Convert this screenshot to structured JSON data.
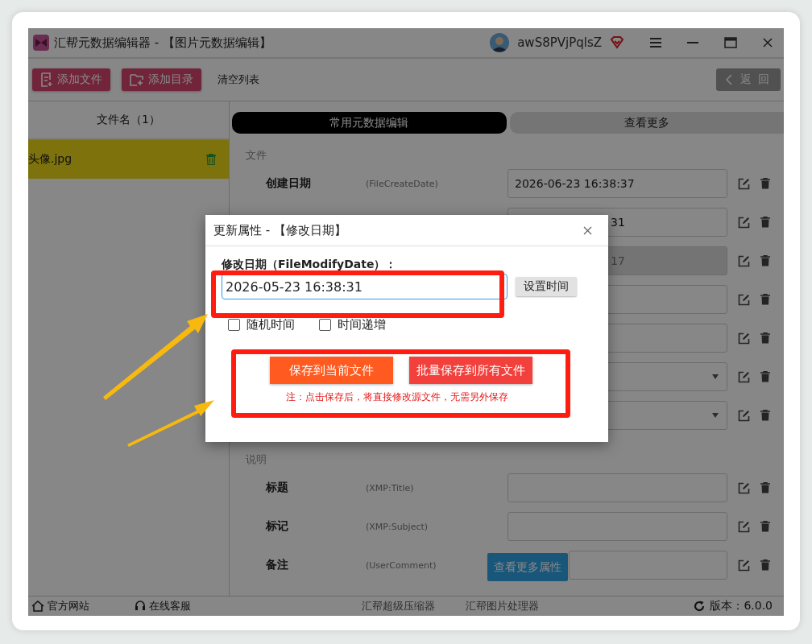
{
  "window": {
    "title": "汇帮元数据编辑器 - 【图片元数据编辑】",
    "user": "awS8PVjPqlsZ"
  },
  "toolbar": {
    "buttons": [
      {
        "label": "添加文件",
        "kind": "file"
      },
      {
        "label": "添加目录",
        "kind": "folder"
      }
    ],
    "clear": "清空列表",
    "back": "返 回"
  },
  "file_list": {
    "header": "文件名（1）",
    "items": [
      {
        "name": "头像.jpg",
        "selected": true
      }
    ]
  },
  "tabs": [
    {
      "label": "常用元数据编辑",
      "selected": true
    },
    {
      "label": "查看更多",
      "selected": false
    }
  ],
  "sections": [
    {
      "title": "文件",
      "rows": [
        {
          "label": "创建日期",
          "tag": "(FileCreateDate)",
          "value": "2026-06-23 16:38:37",
          "kind": "input",
          "disabled": false
        },
        {
          "value": "31",
          "kind": "input",
          "disabled": false
        },
        {
          "value": "17",
          "kind": "input",
          "disabled": true
        },
        {
          "kind": "input",
          "disabled": false
        },
        {
          "kind": "input",
          "disabled": false
        },
        {
          "kind": "select",
          "disabled": false
        },
        {
          "kind": "select",
          "disabled": false
        }
      ]
    },
    {
      "title": "说明",
      "rows": [
        {
          "label": "标题",
          "tag": "(XMP:Title)",
          "kind": "input",
          "disabled": false
        },
        {
          "label": "标记",
          "tag": "(XMP:Subject)",
          "kind": "input",
          "disabled": false
        },
        {
          "label": "备注",
          "tag": "(UserComment)",
          "kind": "input",
          "disabled": false
        }
      ]
    }
  ],
  "more_button": "查看更多属性",
  "footer": {
    "links": [
      {
        "label": "官方网站",
        "kind": "home"
      },
      {
        "label": "在线客服",
        "kind": "support"
      }
    ],
    "products": [
      "汇帮超级压缩器",
      "汇帮图片处理器"
    ],
    "version": "版本：6.0.0"
  },
  "dialog": {
    "title": "更新属性 - 【修改日期】",
    "field_label": "修改日期（FileModifyDate）：",
    "value": "2026-05-23 16:38:31",
    "set_time": "设置时间",
    "options": [
      {
        "label": "随机时间",
        "checked": false
      },
      {
        "label": "时间递增",
        "checked": false
      }
    ],
    "buttons": [
      {
        "label": "保存到当前文件",
        "kind": "current"
      },
      {
        "label": "批量保存到所有文件",
        "kind": "all"
      }
    ],
    "note": "注：点击保存后，将直接修改源文件，无需另外保存"
  }
}
